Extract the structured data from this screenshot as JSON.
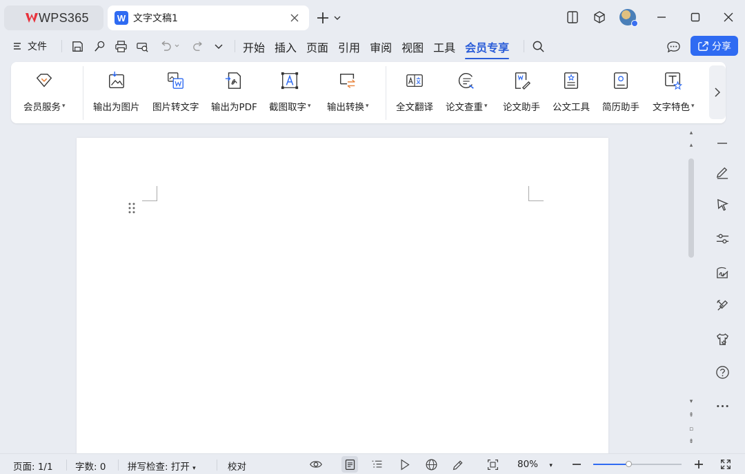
{
  "titlebar": {
    "home_tab": "WPS365",
    "doc_tab": {
      "icon_letter": "W",
      "name": "文字文稿1"
    }
  },
  "menu": {
    "file_label": "文件",
    "tabs": [
      "开始",
      "插入",
      "页面",
      "引用",
      "审阅",
      "视图",
      "工具",
      "会员专享"
    ],
    "active_tab": "会员专享",
    "share_label": "分享"
  },
  "ribbon": {
    "groups": [
      {
        "items": [
          {
            "label": "会员服务",
            "dropdown": true,
            "icon": "diamond-icon"
          }
        ]
      },
      {
        "items": [
          {
            "label": "输出为图片",
            "dropdown": false,
            "icon": "image-export-icon"
          },
          {
            "label": "图片转文字",
            "dropdown": false,
            "icon": "image-to-text-icon"
          },
          {
            "label": "输出为PDF",
            "dropdown": false,
            "icon": "pdf-export-icon"
          },
          {
            "label": "截图取字",
            "dropdown": true,
            "icon": "screenshot-ocr-icon"
          },
          {
            "label": "输出转换",
            "dropdown": true,
            "icon": "convert-icon"
          }
        ]
      },
      {
        "items": [
          {
            "label": "全文翻译",
            "dropdown": false,
            "icon": "translate-icon"
          },
          {
            "label": "论文查重",
            "dropdown": true,
            "icon": "plagiarism-check-icon"
          },
          {
            "label": "论文助手",
            "dropdown": false,
            "icon": "paper-assistant-icon"
          },
          {
            "label": "公文工具",
            "dropdown": false,
            "icon": "official-doc-icon"
          },
          {
            "label": "简历助手",
            "dropdown": false,
            "icon": "resume-icon"
          },
          {
            "label": "文字特色",
            "dropdown": true,
            "icon": "text-feature-icon"
          }
        ]
      }
    ]
  },
  "statusbar": {
    "page": "页面: 1/1",
    "words": "字数: 0",
    "spellcheck": "拼写检查: 打开",
    "proofread": "校对",
    "zoom": "80%",
    "zoom_level": 0.4
  },
  "colors": {
    "accent": "#2f6bf2",
    "active_tab": "#2a5cd8",
    "logo": "#e8323c"
  }
}
